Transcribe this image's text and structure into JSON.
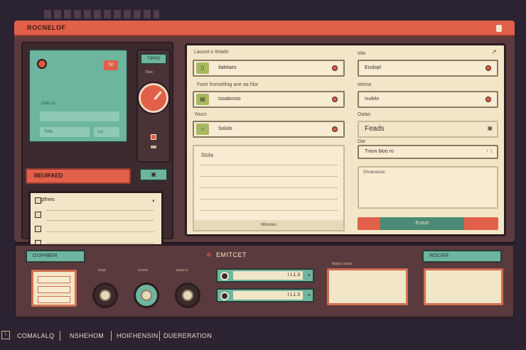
{
  "window": {
    "title": "ROCNELOF"
  },
  "left": {
    "screen": {
      "badge": "M",
      "label": "Oalo ol",
      "btn_a": "Tollo",
      "btn_b": "Lo"
    },
    "red_bar": "REUIFAED",
    "dial": {
      "top_label": "TIPHO",
      "mini_label": "Tolec"
    },
    "chip": "▣",
    "notes": {
      "header": "Lugtlheis",
      "icon": "◐"
    }
  },
  "form": {
    "left_col": {
      "section1": "Lauuot o Itrlado",
      "f1": "Ilalelaes",
      "hint2": "Fastr frsnvellnig ane aa hlor",
      "f2": "Isoalonsio",
      "section3": "Yours",
      "f3": "Solulo",
      "textarea_label": "Itiola",
      "textarea_footer": "Wrarees"
    },
    "right_col": {
      "section1": "Iolo",
      "f1": "Ecolopl",
      "section2": "Ielona",
      "f2": "Isulelo",
      "section3": "Oalas",
      "f3": "Feads",
      "section4": "Dar",
      "select": "Tniun bloo ro",
      "select_arrow": "↑ ↕",
      "area_label": "Orvarvesas",
      "action": "Euturt"
    }
  },
  "console": {
    "tag_left": "OUPHBER",
    "title": "EMITCET",
    "tag_right": "ROCIER",
    "knob_labels": [
      "Ioialr",
      "Ionera",
      "Iaala la"
    ],
    "meter1": "I L1.3",
    "meter2": "I L1.3",
    "display_label1": "Maltoc tnlala",
    "display_label2": ""
  },
  "footer": {
    "icon": "\\",
    "items": [
      "COMALALQ",
      "NSHEHOM",
      "HOIFHENSIN",
      "DUERERATION"
    ]
  },
  "colors": {
    "background": "#2b2232",
    "accent_red": "#e0604a",
    "teal": "#6db59f",
    "paper": "#f2e6c8",
    "panel": "#5a3a3c",
    "olive": "#a8b860"
  }
}
